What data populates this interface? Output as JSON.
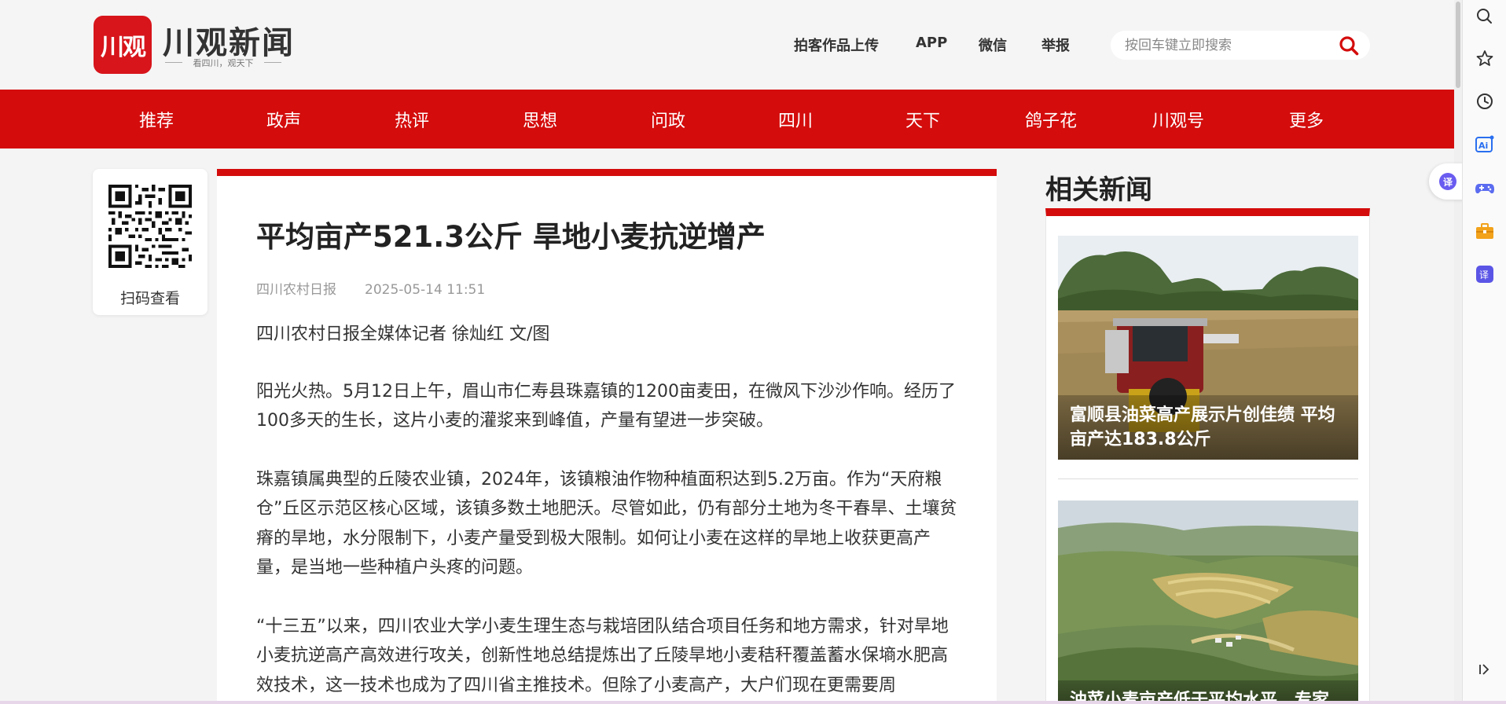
{
  "header": {
    "logo_badge": "川观",
    "logo_title": "川观新闻",
    "logo_slogan": "看四川，观天下",
    "links": [
      "拍客作品上传",
      "APP",
      "微信",
      "举报"
    ],
    "search_placeholder": "按回车键立即搜索",
    "search_value": ""
  },
  "nav": {
    "items": [
      "推荐",
      "政声",
      "热评",
      "思想",
      "问政",
      "四川",
      "天下",
      "鸽子花",
      "川观号",
      "更多"
    ]
  },
  "qr": {
    "label": "扫码查看"
  },
  "article": {
    "title": "平均亩产521.3公斤 旱地小麦抗逆增产",
    "source": "四川农村日报",
    "datetime": "2025-05-14 11:51",
    "author_line": "四川农村日报全媒体记者 徐灿红 文/图",
    "paragraphs": [
      "阳光火热。5月12日上午，眉山市仁寿县珠嘉镇的1200亩麦田，在微风下沙沙作响。经历了100多天的生长，这片小麦的灌浆来到峰值，产量有望进一步突破。",
      "珠嘉镇属典型的丘陵农业镇，2024年，该镇粮油作物种植面积达到5.2万亩。作为“天府粮仓”丘区示范区核心区域，该镇多数土地肥沃。尽管如此，仍有部分土地为冬干春旱、土壤贫瘠的旱地，水分限制下，小麦产量受到极大限制。如何让小麦在这样的旱地上收获更高产量，是当地一些种植户头疼的问题。",
      "“十三五”以来，四川农业大学小麦生理生态与栽培团队结合项目任务和地方需求，针对旱地小麦抗逆高产高效进行攻关，创新性地总结提炼出了丘陵旱地小麦秸秆覆盖蓄水保墒水肥高效技术，这一技术也成为了四川省主推技术。但除了小麦高产，大户们现在更需要周"
    ]
  },
  "sidebar": {
    "title": "相关新闻",
    "news": [
      {
        "title": "富顺县油菜高产展示片创佳绩 平均亩产达183.8公斤"
      },
      {
        "title": "油菜小麦亩产低于平均水平，专家"
      }
    ]
  },
  "toolbar": {
    "icons": [
      "search-icon",
      "star-icon",
      "history-icon",
      "ai-icon",
      "game-icon",
      "toolbox-icon",
      "translate-icon",
      "collapse-icon"
    ],
    "translate_float": "译",
    "translate_label": "译",
    "ai_label": "Ai"
  },
  "colors": {
    "brand_red": "#d40c0c",
    "logo_red": "#d7151b",
    "toolbar_purple": "#6a5cf0",
    "background": "#f4f4f4"
  }
}
